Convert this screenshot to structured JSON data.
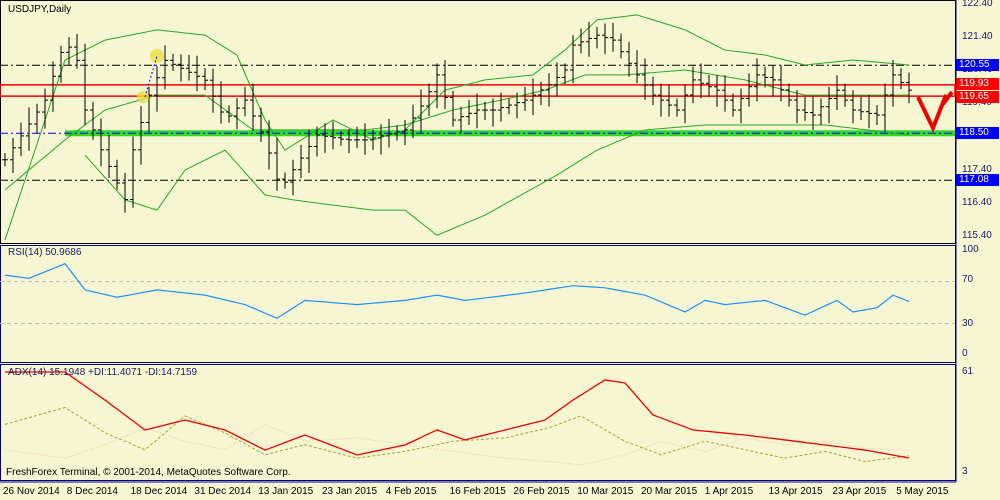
{
  "title": "USDJPY,Daily",
  "copyright": "FreshForex Terminal, © 2001-2014, MetaQuotes Software Corp.",
  "price_axis": [
    "122.40",
    "121.40",
    "120.40",
    "119.40",
    "118.40",
    "117.40",
    "116.40",
    "115.40"
  ],
  "price_tags": [
    {
      "label": "120.55",
      "color": "#0000ff"
    },
    {
      "label": "119.93",
      "color": "#ff0000"
    },
    {
      "label": "119.65",
      "color": "#ff0000"
    },
    {
      "label": "118.50",
      "color": "#0000ff"
    },
    {
      "label": "117.08",
      "color": "#0000ff"
    }
  ],
  "rsi": {
    "label": "RSI(14) 50.9686",
    "axis": [
      "100",
      "70",
      "30",
      "0"
    ]
  },
  "adx": {
    "label": "ADX(14) 15.1948 +DI:11.4071 -DI:14.7159",
    "axis": [
      "61",
      "3"
    ]
  },
  "dates": [
    "26 Nov 2014",
    "8 Dec 2014",
    "18 Dec 2014",
    "31 Dec 2014",
    "13 Jan 2015",
    "23 Jan 2015",
    "4 Feb 2015",
    "16 Feb 2015",
    "26 Feb 2015",
    "10 Mar 2015",
    "20 Mar 2015",
    "1 Apr 2015",
    "13 Apr 2015",
    "23 Apr 2015",
    "5 May 2015"
  ],
  "chart_data": {
    "type": "line",
    "symbol": "USDJPY",
    "timeframe": "Daily",
    "ylim": [
      115.4,
      122.4
    ],
    "close_keypoints": [
      [
        0,
        117.7
      ],
      [
        2.5,
        118.6
      ],
      [
        5,
        119.5
      ],
      [
        7.5,
        121.3
      ],
      [
        9,
        120.7
      ],
      [
        10,
        119.2
      ],
      [
        12,
        118.0
      ],
      [
        15,
        116.5
      ],
      [
        16,
        118.0
      ],
      [
        18,
        119.65
      ],
      [
        20,
        120.7
      ],
      [
        22.5,
        120.4
      ],
      [
        25,
        120.1
      ],
      [
        27.5,
        118.9
      ],
      [
        30,
        119.5
      ],
      [
        32.5,
        118.3
      ],
      [
        34.4,
        116.8
      ],
      [
        36,
        117.4
      ],
      [
        39,
        118.45
      ],
      [
        42.5,
        118.3
      ],
      [
        45,
        118.3
      ],
      [
        50,
        118.6
      ],
      [
        52.5,
        119.5
      ],
      [
        54,
        120.26
      ],
      [
        56,
        118.9
      ],
      [
        59,
        119.2
      ],
      [
        61,
        119.2
      ],
      [
        65,
        119.5
      ],
      [
        68,
        119.96
      ],
      [
        70,
        120.41
      ],
      [
        71,
        121.16
      ],
      [
        74,
        121.46
      ],
      [
        76,
        121.31
      ],
      [
        79,
        120.26
      ],
      [
        81,
        119.65
      ],
      [
        84,
        119.2
      ],
      [
        86,
        120.11
      ],
      [
        89,
        119.8
      ],
      [
        91,
        119.2
      ],
      [
        94,
        120.26
      ],
      [
        96,
        120.11
      ],
      [
        99,
        119.2
      ],
      [
        101,
        119.05
      ],
      [
        104,
        119.8
      ],
      [
        106,
        119.2
      ],
      [
        109,
        119.05
      ],
      [
        111,
        120.26
      ],
      [
        113,
        119.8
      ]
    ],
    "bb_upper": [
      [
        0,
        115.28
      ],
      [
        7.5,
        120.71
      ],
      [
        12.5,
        121.31
      ],
      [
        19,
        121.62
      ],
      [
        25,
        121.46
      ],
      [
        29,
        120.86
      ],
      [
        32.5,
        118.9
      ],
      [
        35,
        117.99
      ],
      [
        41,
        118.9
      ],
      [
        46,
        118.3
      ],
      [
        50,
        118.6
      ],
      [
        55,
        119.8
      ],
      [
        60,
        120.11
      ],
      [
        66,
        120.26
      ],
      [
        70,
        121.01
      ],
      [
        74,
        121.92
      ],
      [
        79,
        122.07
      ],
      [
        85,
        121.62
      ],
      [
        90,
        121.01
      ],
      [
        95,
        120.86
      ],
      [
        100,
        120.56
      ],
      [
        106,
        120.71
      ],
      [
        113,
        120.56
      ]
    ],
    "bb_middle": [
      [
        0,
        116.79
      ],
      [
        7.5,
        118.3
      ],
      [
        12.5,
        119.2
      ],
      [
        19,
        119.65
      ],
      [
        25,
        119.65
      ],
      [
        31,
        118.6
      ],
      [
        37.5,
        118.6
      ],
      [
        45,
        118.6
      ],
      [
        50,
        118.75
      ],
      [
        56,
        119.2
      ],
      [
        62,
        119.5
      ],
      [
        67.5,
        119.8
      ],
      [
        72.5,
        120.26
      ],
      [
        77.5,
        120.26
      ],
      [
        85,
        120.41
      ],
      [
        92.5,
        120.11
      ],
      [
        100,
        119.65
      ],
      [
        107.5,
        119.65
      ],
      [
        113,
        119.65
      ]
    ],
    "bb_lower": [
      [
        10,
        117.84
      ],
      [
        15,
        116.49
      ],
      [
        19,
        116.18
      ],
      [
        22.5,
        117.39
      ],
      [
        27.5,
        117.99
      ],
      [
        32.5,
        116.64
      ],
      [
        36,
        116.49
      ],
      [
        41,
        116.33
      ],
      [
        46,
        116.18
      ],
      [
        50,
        116.18
      ],
      [
        54,
        115.42
      ],
      [
        60,
        116.03
      ],
      [
        69,
        117.24
      ],
      [
        74,
        117.99
      ],
      [
        80,
        118.6
      ],
      [
        87.5,
        118.75
      ],
      [
        95,
        118.75
      ],
      [
        102.5,
        118.75
      ],
      [
        113,
        118.45
      ]
    ],
    "levels": [
      {
        "price": 120.55,
        "style": "dash-dot"
      },
      {
        "price": 119.93,
        "style": "red"
      },
      {
        "price": 119.65,
        "style": "red"
      },
      {
        "price": 118.5,
        "style": "green"
      },
      {
        "price": 117.08,
        "style": "dash-dot"
      }
    ],
    "rsi_keypoints": [
      [
        0,
        76
      ],
      [
        3,
        73
      ],
      [
        7.5,
        87
      ],
      [
        10,
        62
      ],
      [
        14,
        55
      ],
      [
        19,
        62
      ],
      [
        25,
        57
      ],
      [
        30,
        48
      ],
      [
        34,
        35
      ],
      [
        37.5,
        52
      ],
      [
        44,
        48
      ],
      [
        50,
        52
      ],
      [
        54,
        57
      ],
      [
        57.5,
        52
      ],
      [
        65,
        59
      ],
      [
        71,
        66
      ],
      [
        75,
        64
      ],
      [
        80,
        57
      ],
      [
        85,
        41
      ],
      [
        87.5,
        52
      ],
      [
        90,
        48
      ],
      [
        95,
        52
      ],
      [
        100,
        38
      ],
      [
        104,
        52
      ],
      [
        106,
        41
      ],
      [
        109,
        45
      ],
      [
        111,
        57
      ],
      [
        113,
        51
      ]
    ],
    "adx_keypoints": [
      [
        0,
        61
      ],
      [
        7.5,
        61
      ],
      [
        12.5,
        44.4
      ],
      [
        17.5,
        26.7
      ],
      [
        22.5,
        32.6
      ],
      [
        27.5,
        26.7
      ],
      [
        32.5,
        14.8
      ],
      [
        37.5,
        23.7
      ],
      [
        44,
        11.9
      ],
      [
        50,
        17.8
      ],
      [
        54,
        26.7
      ],
      [
        57.5,
        20.8
      ],
      [
        62.5,
        26.7
      ],
      [
        67.5,
        32.6
      ],
      [
        71,
        44.4
      ],
      [
        75,
        56.3
      ],
      [
        77.5,
        54.5
      ],
      [
        81,
        35.6
      ],
      [
        86,
        26.7
      ],
      [
        92.5,
        23.7
      ],
      [
        97.5,
        20.8
      ],
      [
        102.5,
        17.8
      ],
      [
        107.5,
        14.8
      ],
      [
        113,
        10.1
      ]
    ],
    "plus_di_keypoints": [
      [
        0,
        30
      ],
      [
        7.5,
        40
      ],
      [
        12.5,
        25
      ],
      [
        17.5,
        15
      ],
      [
        22.5,
        35
      ],
      [
        27.5,
        25
      ],
      [
        32.5,
        12
      ],
      [
        37.5,
        18
      ],
      [
        44,
        10
      ],
      [
        50,
        14
      ],
      [
        56,
        20
      ],
      [
        62.5,
        22
      ],
      [
        68,
        28
      ],
      [
        72,
        35
      ],
      [
        77.5,
        20
      ],
      [
        82,
        12
      ],
      [
        87.5,
        20
      ],
      [
        92.5,
        15
      ],
      [
        97.5,
        10
      ],
      [
        102.5,
        14
      ],
      [
        107.5,
        8
      ],
      [
        113,
        11.4
      ]
    ],
    "minus_di_keypoints": [
      [
        0,
        15
      ],
      [
        7.5,
        10
      ],
      [
        12.5,
        18
      ],
      [
        17.5,
        28
      ],
      [
        22.5,
        20
      ],
      [
        27.5,
        15
      ],
      [
        32.5,
        30
      ],
      [
        37.5,
        20
      ],
      [
        44,
        22
      ],
      [
        50,
        18
      ],
      [
        56,
        14
      ],
      [
        62.5,
        10
      ],
      [
        68,
        8
      ],
      [
        72,
        6
      ],
      [
        77.5,
        12
      ],
      [
        82,
        20
      ],
      [
        87.5,
        14
      ],
      [
        92.5,
        22
      ],
      [
        97.5,
        18
      ],
      [
        102.5,
        20
      ],
      [
        107.5,
        16
      ],
      [
        113,
        14.7
      ]
    ]
  }
}
